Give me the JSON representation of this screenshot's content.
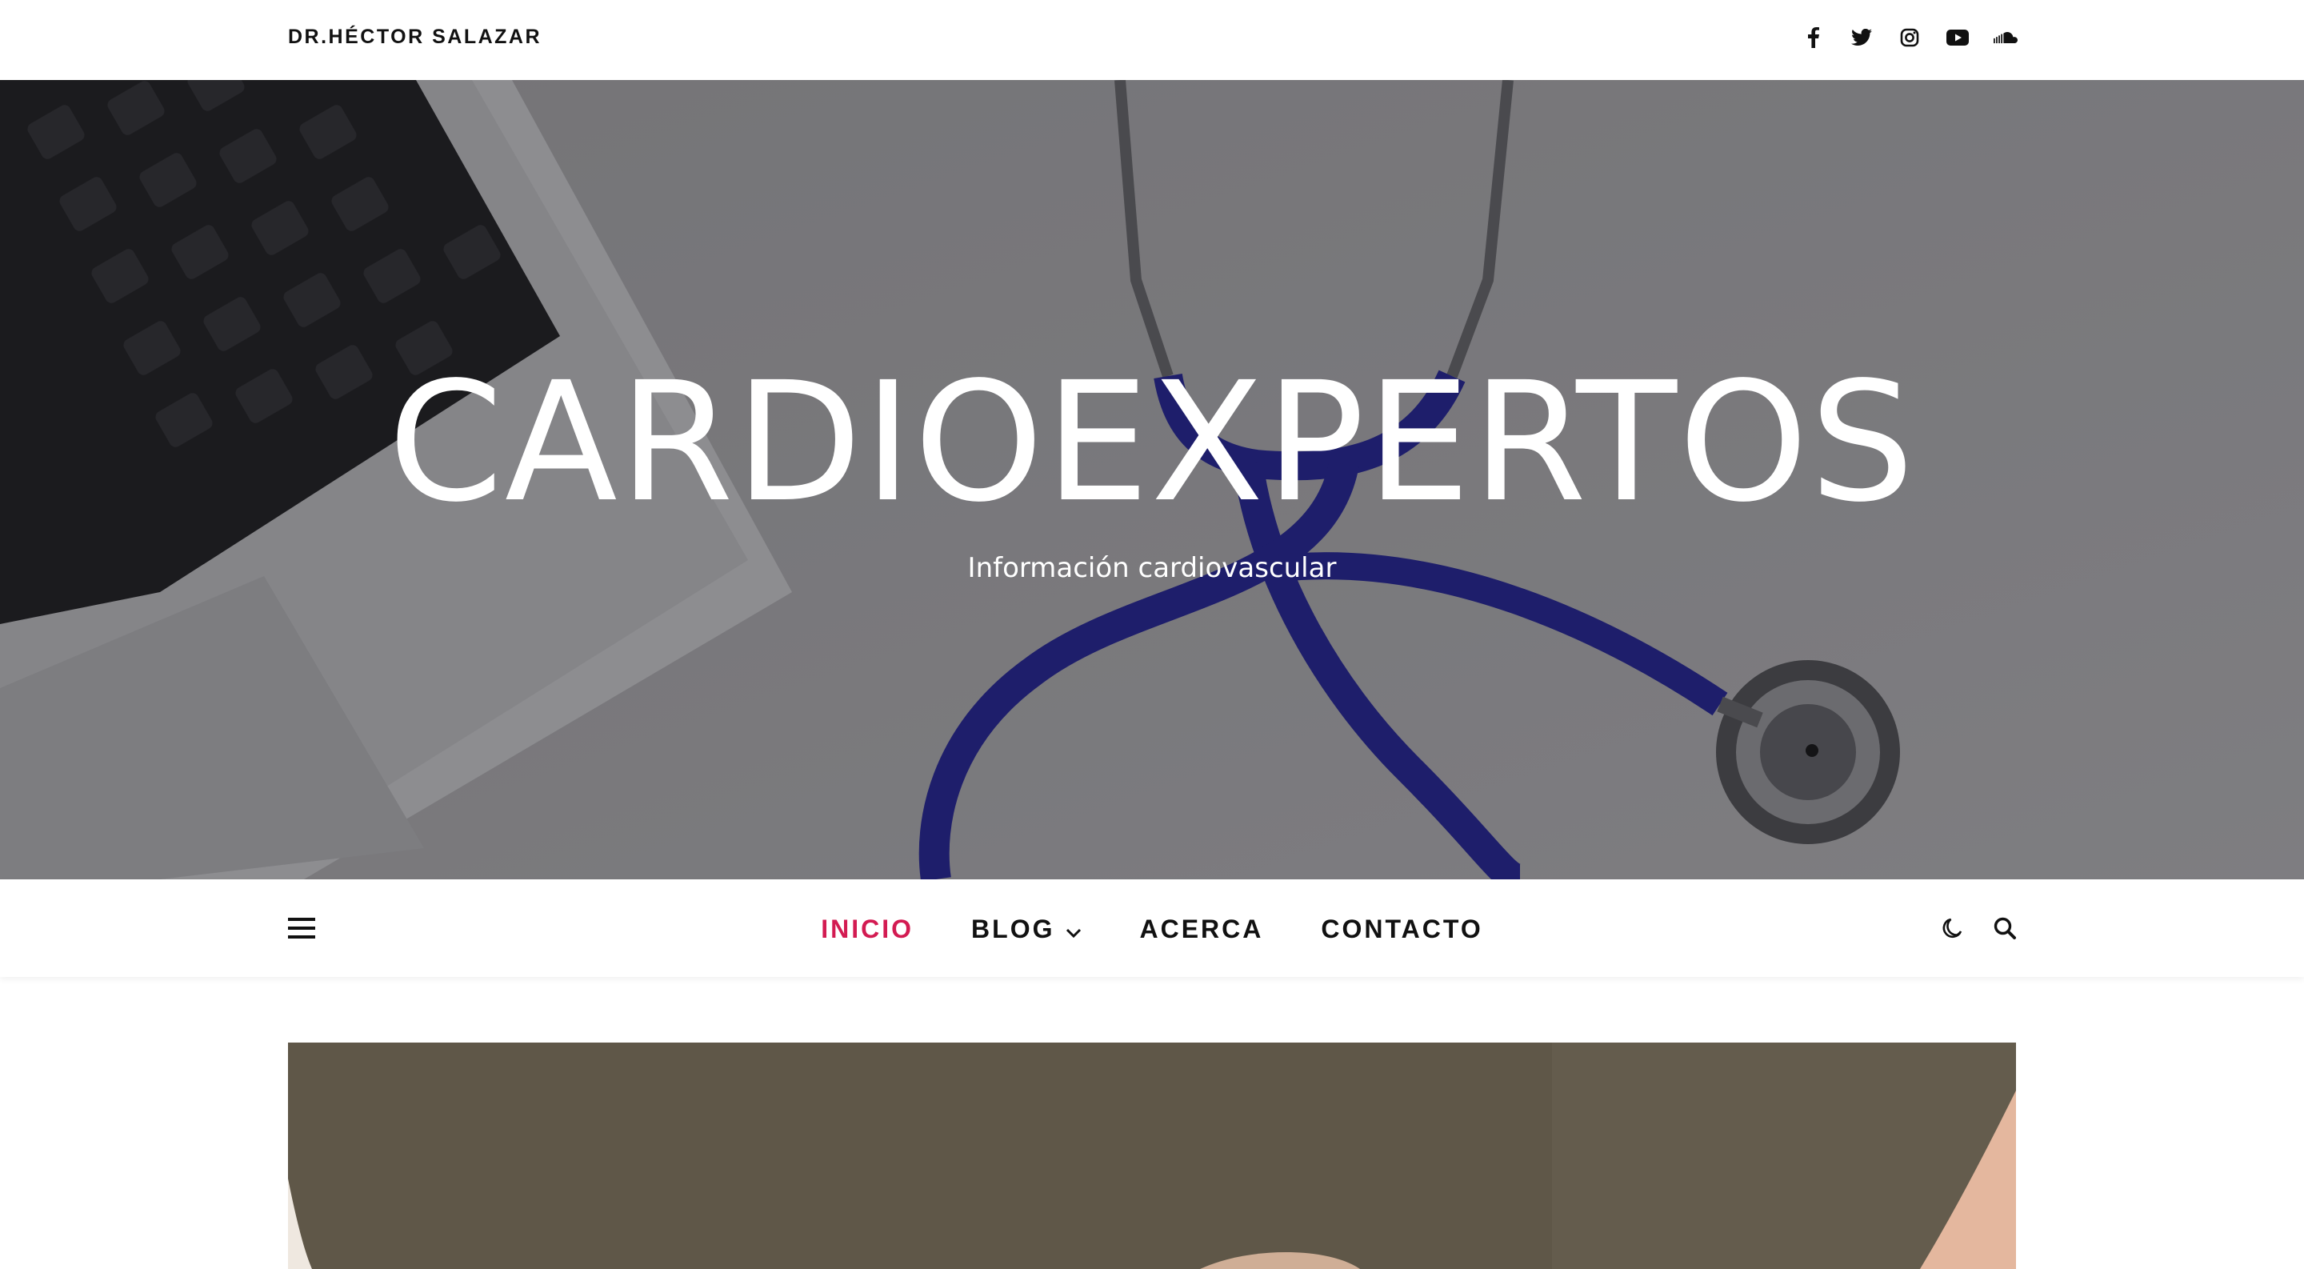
{
  "header": {
    "site_owner": "DR.HÉCTOR SALAZAR",
    "social_icons": [
      "facebook-icon",
      "twitter-icon",
      "instagram-icon",
      "youtube-icon",
      "soundcloud-icon"
    ]
  },
  "hero": {
    "title": "CARDIOEXPERTOS",
    "subtitle": "Información cardiovascular"
  },
  "nav": {
    "items": [
      {
        "label": "INICIO",
        "active": true
      },
      {
        "label": "BLOG",
        "has_dropdown": true
      },
      {
        "label": "ACERCA"
      },
      {
        "label": "CONTACTO"
      }
    ],
    "tools": [
      "dark-mode-moon-icon",
      "search-icon"
    ]
  },
  "colors": {
    "accent": "#d31b52",
    "text": "#111111",
    "stethoscope_tube": "#1f1f8a"
  }
}
